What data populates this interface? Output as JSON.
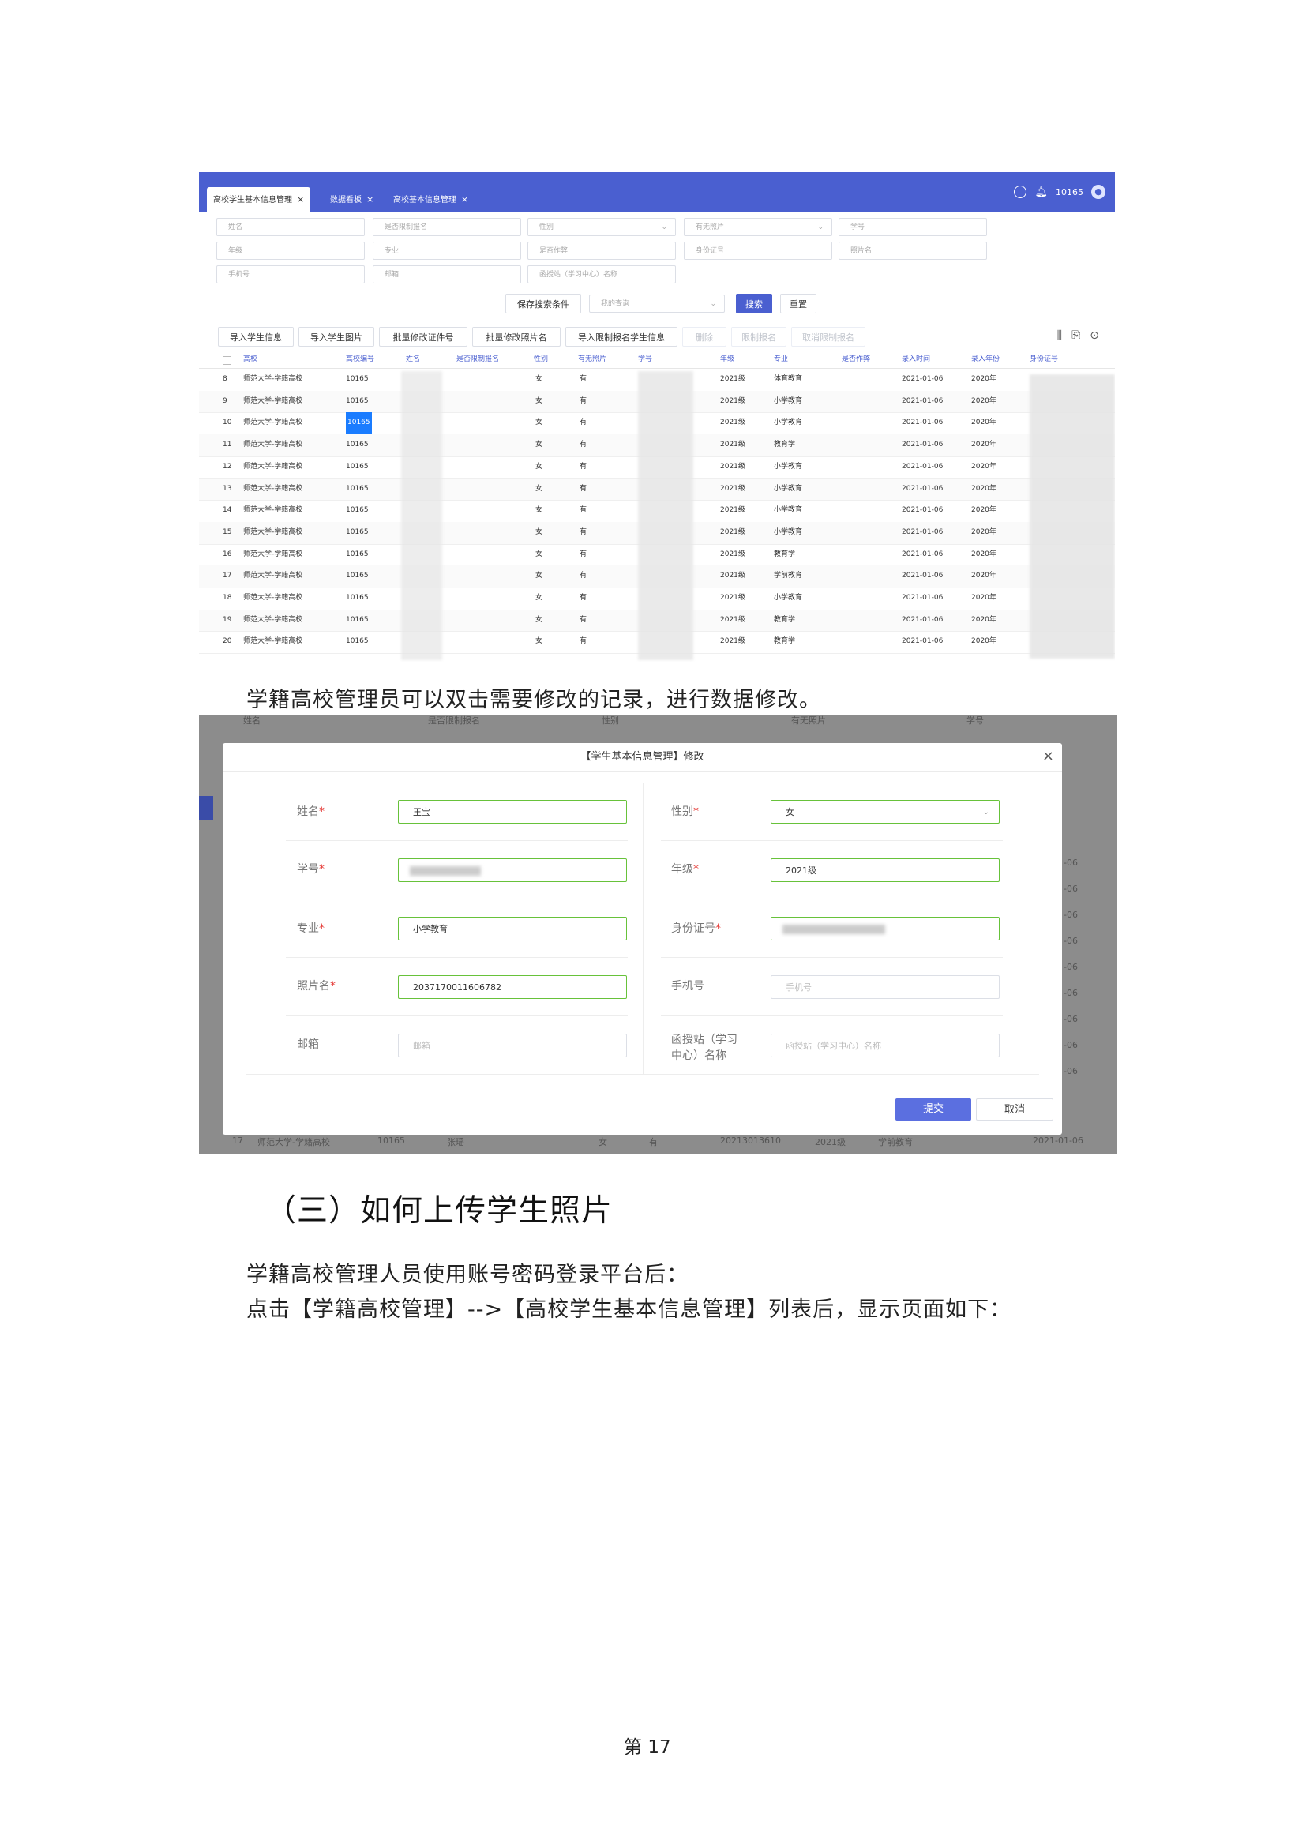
{
  "shot1": {
    "tabs": [
      {
        "label": "高校学生基本信息管理",
        "active": true
      },
      {
        "label": "数据看板",
        "active": false
      },
      {
        "label": "高校基本信息管理",
        "active": false
      }
    ],
    "header": {
      "user_id": "10165",
      "icons": [
        "compass-icon",
        "bell-icon",
        "avatar-icon"
      ]
    },
    "filters": [
      "姓名",
      "是否限制报名",
      "性别",
      "有无照片",
      "学号",
      "年级",
      "专业",
      "是否作弊",
      "身份证号",
      "照片名",
      "手机号",
      "邮箱",
      "函授站（学习中心）名称"
    ],
    "search_bar": {
      "save_label": "保存搜索条件",
      "query_placeholder": "我的查询",
      "search_label": "搜索",
      "reset_label": "重置"
    },
    "toolbar": [
      "导入学生信息",
      "导入学生图片",
      "批量修改证件号",
      "批量修改照片名",
      "导入限制报名学生信息",
      "删除",
      "限制报名",
      "取消限制报名"
    ],
    "columns": [
      "高校",
      "高校编号",
      "姓名",
      "是否限制报名",
      "性别",
      "有无照片",
      "学号",
      "年级",
      "专业",
      "是否作弊",
      "录入时间",
      "录入年份",
      "身份证号"
    ],
    "rows": [
      {
        "idx": "8",
        "school": "师范大学-学籍高校",
        "code": "10165",
        "gender": "女",
        "photo": "有",
        "grade": "2021级",
        "major": "体育教育",
        "time": "2021-01-06",
        "year": "2020年"
      },
      {
        "idx": "9",
        "school": "师范大学-学籍高校",
        "code": "10165",
        "gender": "女",
        "photo": "有",
        "grade": "2021级",
        "major": "小学教育",
        "time": "2021-01-06",
        "year": "2020年"
      },
      {
        "idx": "10",
        "school": "师范大学-学籍高校",
        "code": "10165",
        "gender": "女",
        "photo": "有",
        "grade": "2021级",
        "major": "小学教育",
        "time": "2021-01-06",
        "year": "2020年"
      },
      {
        "idx": "11",
        "school": "师范大学-学籍高校",
        "code": "10165",
        "gender": "女",
        "photo": "有",
        "grade": "2021级",
        "major": "教育学",
        "time": "2021-01-06",
        "year": "2020年"
      },
      {
        "idx": "12",
        "school": "师范大学-学籍高校",
        "code": "10165",
        "gender": "女",
        "photo": "有",
        "grade": "2021级",
        "major": "小学教育",
        "time": "2021-01-06",
        "year": "2020年"
      },
      {
        "idx": "13",
        "school": "师范大学-学籍高校",
        "code": "10165",
        "gender": "女",
        "photo": "有",
        "grade": "2021级",
        "major": "小学教育",
        "time": "2021-01-06",
        "year": "2020年"
      },
      {
        "idx": "14",
        "school": "师范大学-学籍高校",
        "code": "10165",
        "gender": "女",
        "photo": "有",
        "grade": "2021级",
        "major": "小学教育",
        "time": "2021-01-06",
        "year": "2020年"
      },
      {
        "idx": "15",
        "school": "师范大学-学籍高校",
        "code": "10165",
        "gender": "女",
        "photo": "有",
        "grade": "2021级",
        "major": "小学教育",
        "time": "2021-01-06",
        "year": "2020年"
      },
      {
        "idx": "16",
        "school": "师范大学-学籍高校",
        "code": "10165",
        "gender": "女",
        "photo": "有",
        "grade": "2021级",
        "major": "教育学",
        "time": "2021-01-06",
        "year": "2020年"
      },
      {
        "idx": "17",
        "school": "师范大学-学籍高校",
        "code": "10165",
        "gender": "女",
        "photo": "有",
        "grade": "2021级",
        "major": "学前教育",
        "time": "2021-01-06",
        "year": "2020年"
      },
      {
        "idx": "18",
        "school": "师范大学-学籍高校",
        "code": "10165",
        "gender": "女",
        "photo": "有",
        "grade": "2021级",
        "major": "小学教育",
        "time": "2021-01-06",
        "year": "2020年"
      },
      {
        "idx": "19",
        "school": "师范大学-学籍高校",
        "code": "10165",
        "gender": "女",
        "photo": "有",
        "grade": "2021级",
        "major": "教育学",
        "time": "2021-01-06",
        "year": "2020年"
      },
      {
        "idx": "20",
        "school": "师范大学-学籍高校",
        "code": "10165",
        "gender": "女",
        "photo": "有",
        "grade": "2021级",
        "major": "教育学",
        "time": "2021-01-06",
        "year": "2020年"
      }
    ]
  },
  "text": {
    "para1": "学籍高校管理员可以双击需要修改的记录，进行数据修改。",
    "heading": "（三）如何上传学生照片",
    "para2": "学籍高校管理人员使用账号密码登录平台后：",
    "para3": "点击【学籍高校管理】-->【高校学生基本信息管理】列表后，显示页面如下：",
    "page_prefix": "第",
    "page_number": "17"
  },
  "shot2": {
    "background": {
      "top_labels": [
        "姓名",
        "是否限制报名",
        "性别",
        "有无照片",
        "学号"
      ],
      "bottom_row": {
        "idx": "17",
        "school": "师范大学-学籍高校",
        "code": "10165",
        "name": "张瑶",
        "gender": "女",
        "photo": "有",
        "student_no": "20213013610",
        "grade": "2021级",
        "major": "学前教育",
        "time": "2021-01-06"
      },
      "right_dates": [
        "-06",
        "-06",
        "-06",
        "-06",
        "-06",
        "-06",
        "-06",
        "-06",
        "-06"
      ]
    },
    "dialog": {
      "title": "【学生基本信息管理】修改",
      "fields": {
        "name": {
          "label": "姓名",
          "value": "王宝"
        },
        "gender": {
          "label": "性别",
          "value": "女"
        },
        "student_no": {
          "label": "学号",
          "value": ""
        },
        "grade": {
          "label": "年级",
          "value": "2021级"
        },
        "major": {
          "label": "专业",
          "value": "小学教育"
        },
        "id_no": {
          "label": "身份证号",
          "value": ""
        },
        "photo_name": {
          "label": "照片名",
          "value": "2037170011606782"
        },
        "phone": {
          "label": "手机号",
          "placeholder": "手机号"
        },
        "email": {
          "label": "邮箱",
          "placeholder": "邮箱"
        },
        "station": {
          "label": "函授站（学习中心）名称",
          "placeholder": "函授站（学习中心）名称"
        }
      },
      "required_mark": "*",
      "submit_label": "提交",
      "cancel_label": "取消"
    }
  }
}
